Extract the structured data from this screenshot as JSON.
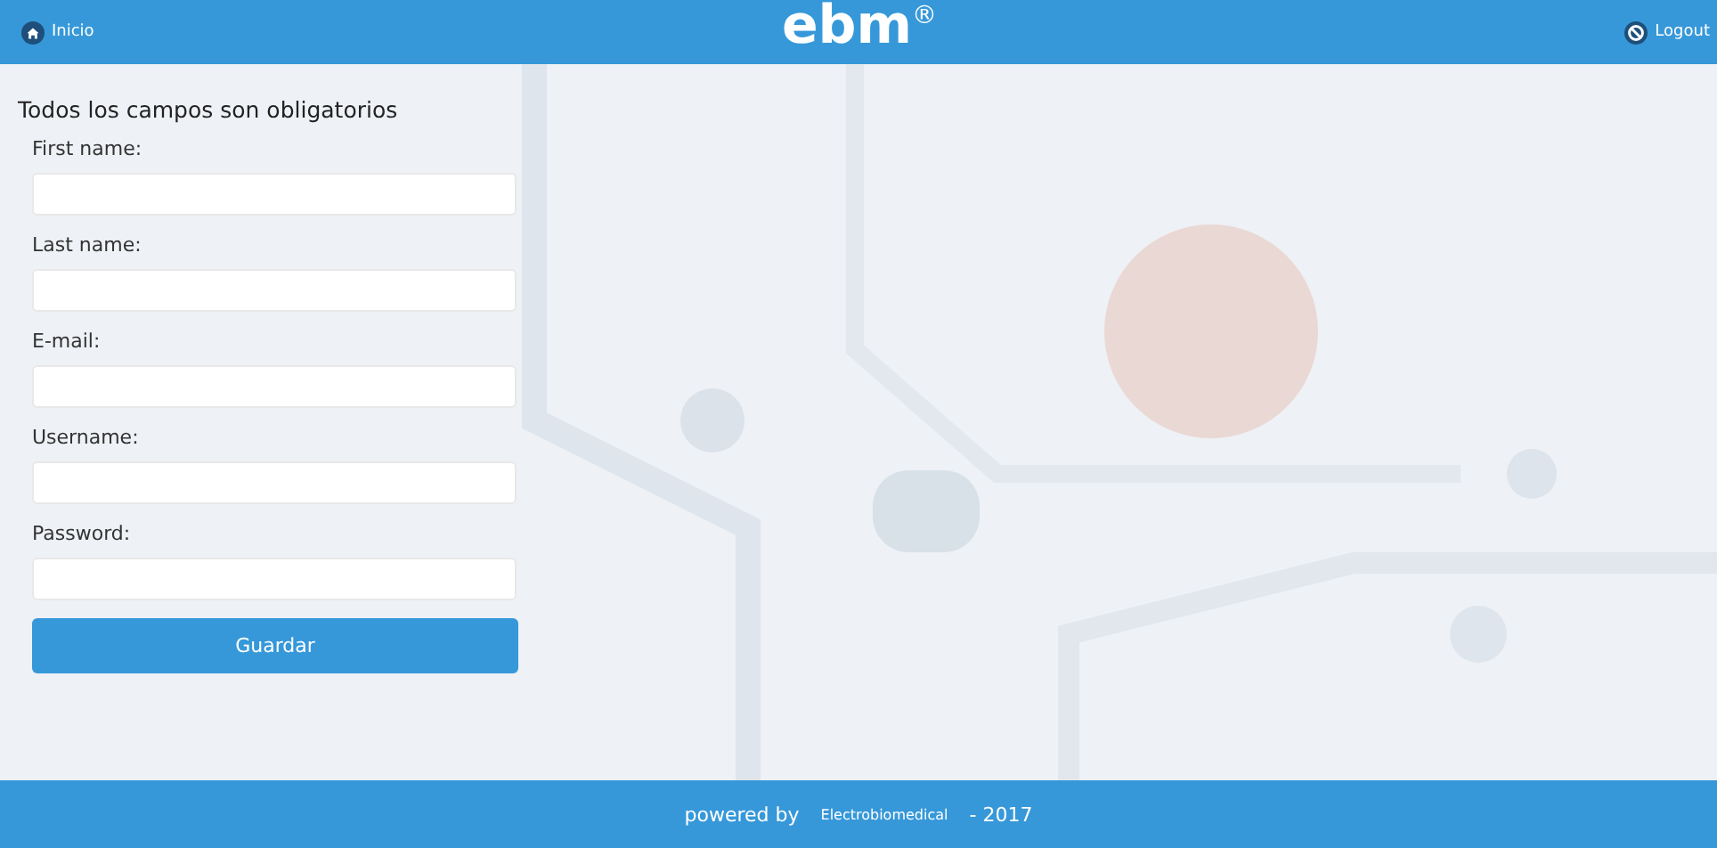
{
  "header": {
    "home_link": "Inicio",
    "logo": "ebm$^{®}$",
    "logout_link": "Logout"
  },
  "form": {
    "notice": "Todos los campos son obligatorios",
    "fields": [
      {
        "label": "First name:"
      },
      {
        "label": "Last name:"
      },
      {
        "label": "E-mail:"
      },
      {
        "label": "Username:"
      },
      {
        "label": "Password:"
      }
    ],
    "submit": "Guardar"
  },
  "footer": {
    "powered": "powered by",
    "company": "Electrobiomedical",
    "year": "- 2017"
  }
}
